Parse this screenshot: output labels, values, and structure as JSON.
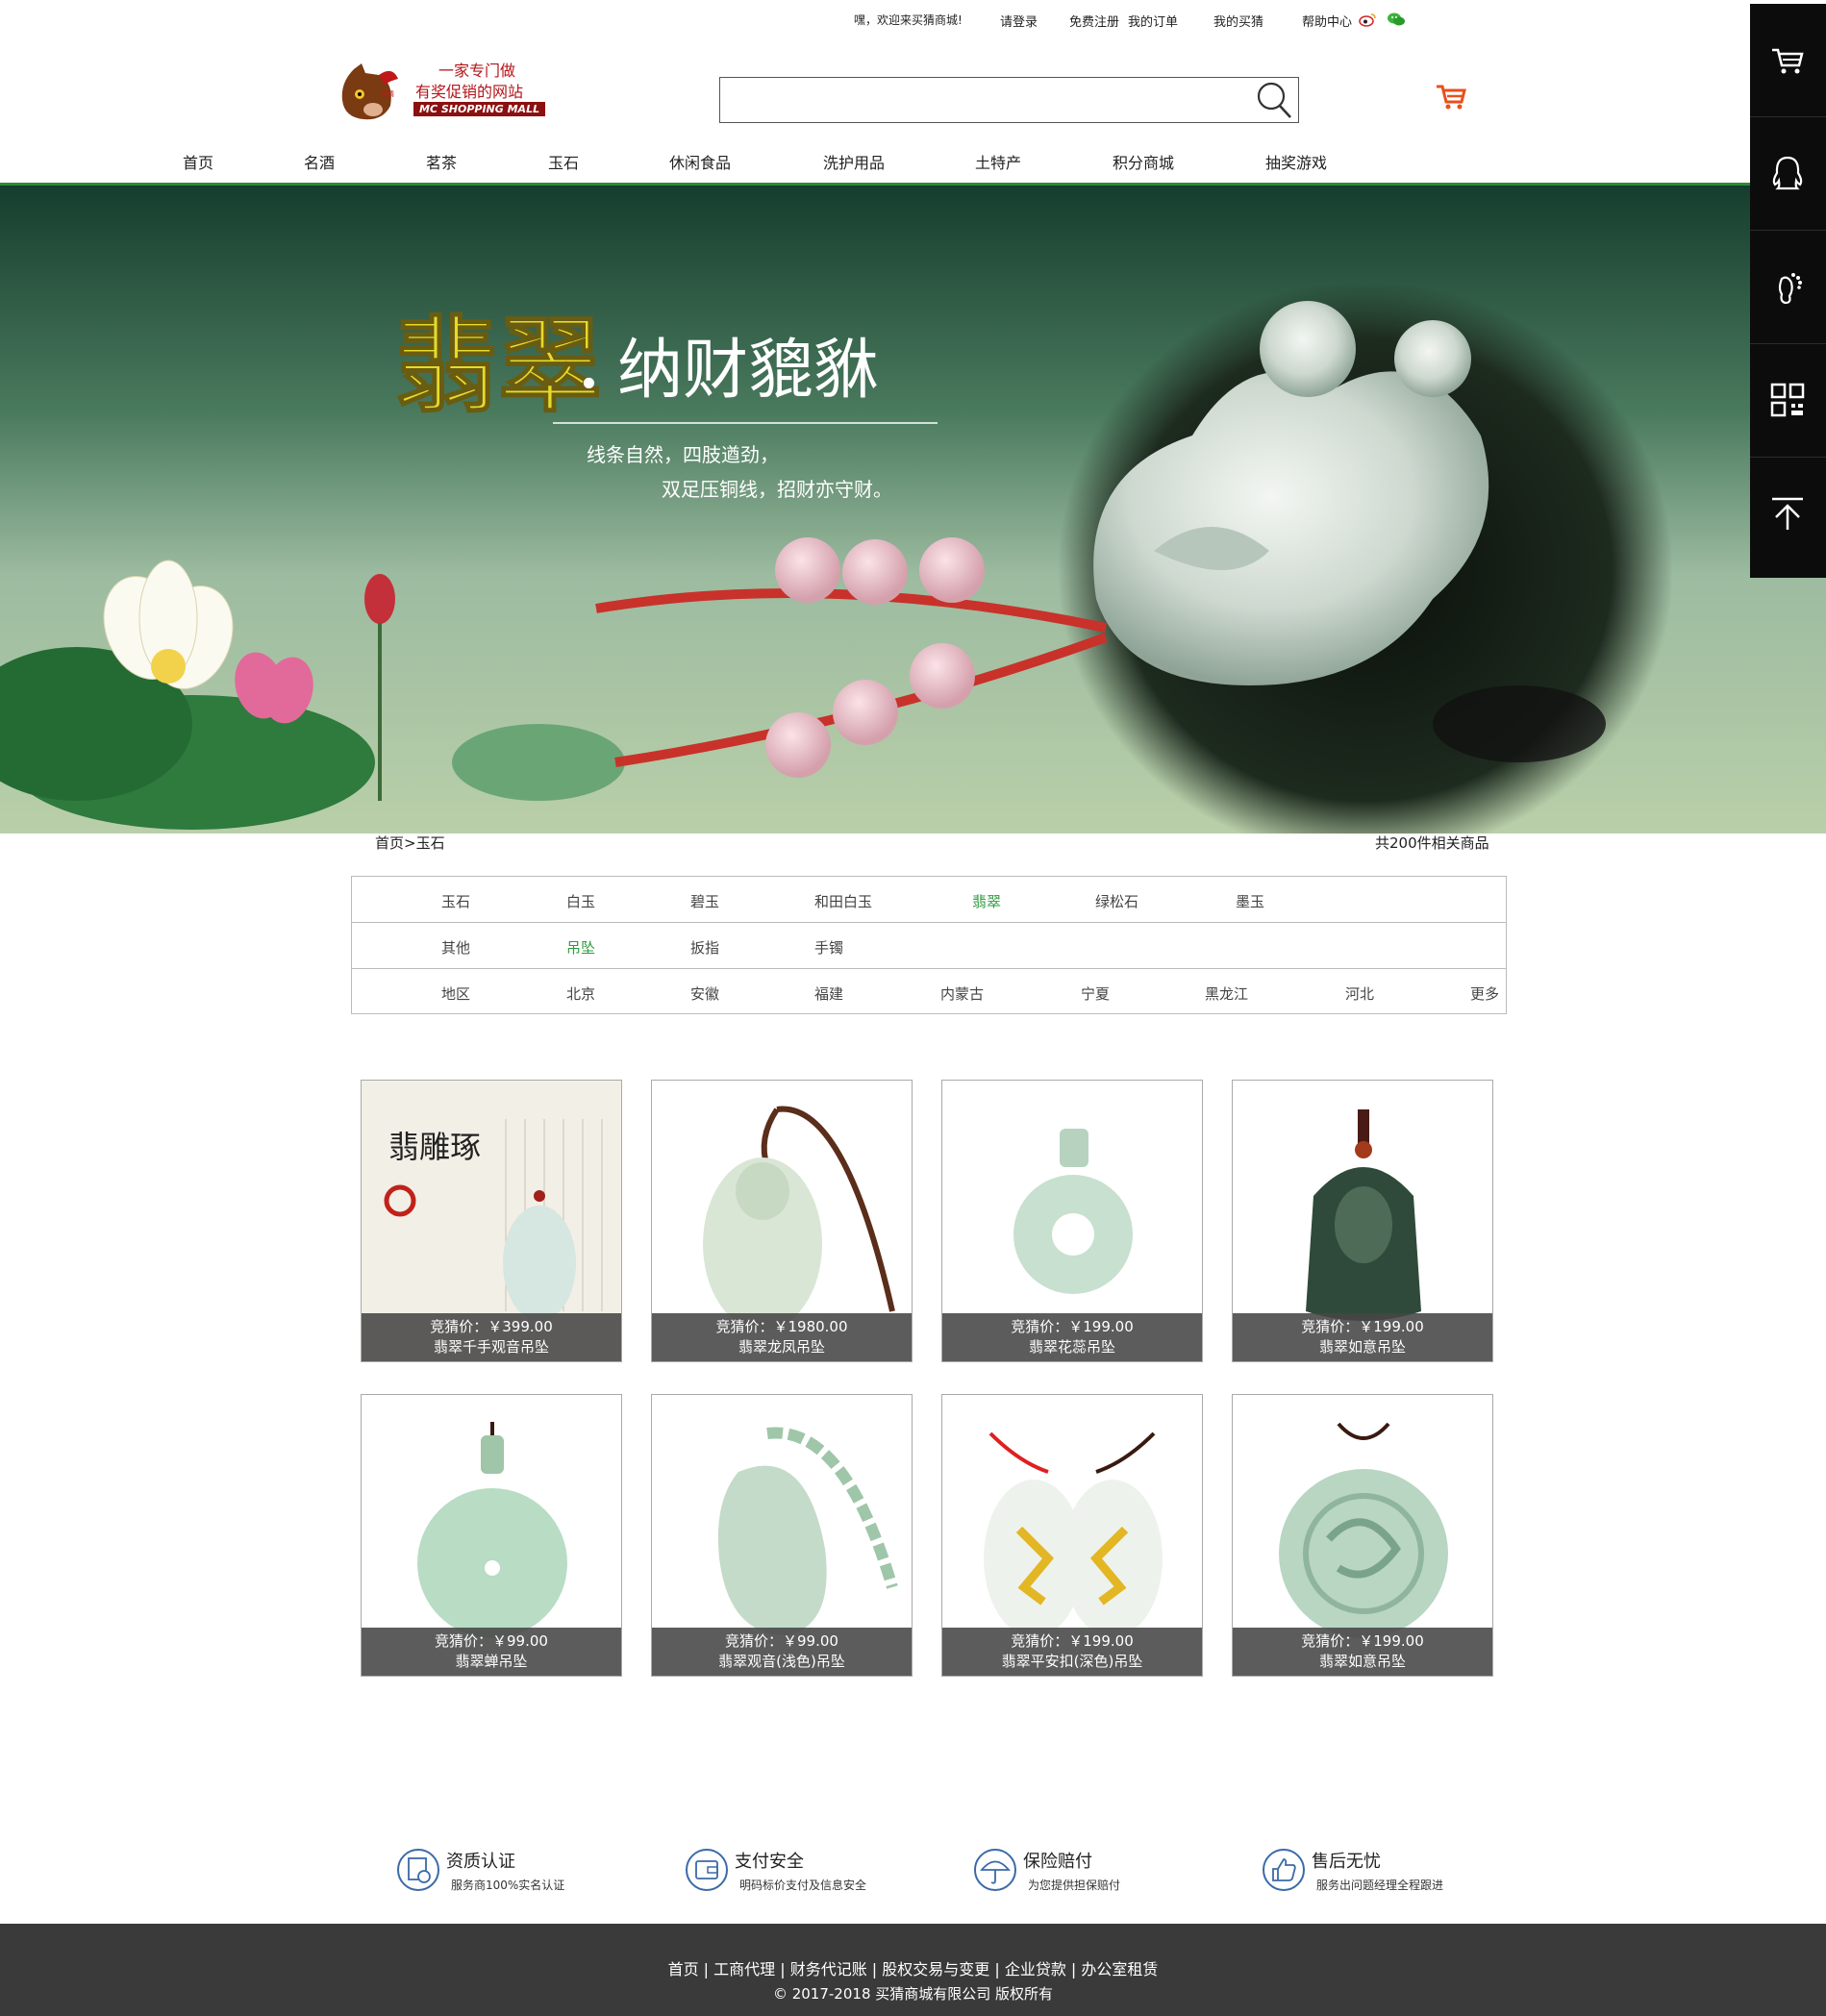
{
  "topbar": {
    "welcome": "嘿，欢迎来买猜商城!",
    "login": "请登录",
    "register": "免费注册",
    "my_orders": "我的订单",
    "my_guess": "我的买猜",
    "help": "帮助中心"
  },
  "logo": {
    "line1": "一家专门做",
    "line2": "有奖促销的网站",
    "line3": "MC SHOPPING MALL"
  },
  "search": {
    "placeholder": "",
    "value": ""
  },
  "nav": [
    "首页",
    "名酒",
    "茗茶",
    "玉石",
    "休闲食品",
    "洗护用品",
    "土特产",
    "积分商城",
    "抽奖游戏"
  ],
  "banner": {
    "title_big": "翡翠",
    "title_dot": ".",
    "title_rest": "纳财貔貅",
    "line1": "线条自然，四肢遒劲，",
    "line2": "双足压铜线，招财亦守财。"
  },
  "breadcrumb": {
    "text": "首页>玉石",
    "count": "共200件相关商品"
  },
  "filters": {
    "row1": [
      "玉石",
      "白玉",
      "碧玉",
      "和田白玉",
      "翡翠",
      "绿松石",
      "墨玉"
    ],
    "row2": [
      "其他",
      "吊坠",
      "扳指",
      "手镯"
    ],
    "row3": [
      "地区",
      "北京",
      "安徽",
      "福建",
      "内蒙古",
      "宁夏",
      "黑龙江",
      "河北",
      "更多"
    ],
    "active": [
      "翡翠",
      "吊坠"
    ]
  },
  "products": [
    {
      "price": "竞猜价：￥399.00",
      "name": "翡翠千手观音吊坠"
    },
    {
      "price": "竞猜价：￥1980.00",
      "name": "翡翠龙凤吊坠"
    },
    {
      "price": "竞猜价：￥199.00",
      "name": "翡翠花蕊吊坠"
    },
    {
      "price": "竞猜价：￥199.00",
      "name": "翡翠如意吊坠"
    },
    {
      "price": "竞猜价：￥99.00",
      "name": "翡翠蝉吊坠"
    },
    {
      "price": "竞猜价：￥99.00",
      "name": "翡翠观音(浅色)吊坠"
    },
    {
      "price": "竞猜价：￥199.00",
      "name": "翡翠平安扣(深色)吊坠"
    },
    {
      "price": "竞猜价：￥199.00",
      "name": "翡翠如意吊坠"
    }
  ],
  "product_art_text": {
    "jade_carving": "翡雕琢"
  },
  "guarantees": [
    {
      "title": "资质认证",
      "sub": "服务商100%实名认证",
      "icon": "certificate-icon"
    },
    {
      "title": "支付安全",
      "sub": "明码标价支付及信息安全",
      "icon": "wallet-icon"
    },
    {
      "title": "保险赔付",
      "sub": "为您提供担保赔付",
      "icon": "umbrella-icon"
    },
    {
      "title": "售后无忧",
      "sub": "服务出问题经理全程跟进",
      "icon": "thumbs-up-icon"
    }
  ],
  "footer": {
    "links": "首页 | 工商代理 | 财务代记账 | 股权交易与变更 | 企业贷款 | 办公室租赁",
    "copyright": "© 2017-2018 买猜商城有限公司 版权所有"
  },
  "side_toolbar": [
    "cart-icon",
    "qq-icon",
    "footprint-icon",
    "qrcode-icon",
    "back-to-top-icon"
  ],
  "colors": {
    "accent_green": "#2e8b37",
    "active_filter": "#2e9b3e",
    "cart_orange": "#e8501c",
    "footer_bg": "#3a3a3a"
  }
}
